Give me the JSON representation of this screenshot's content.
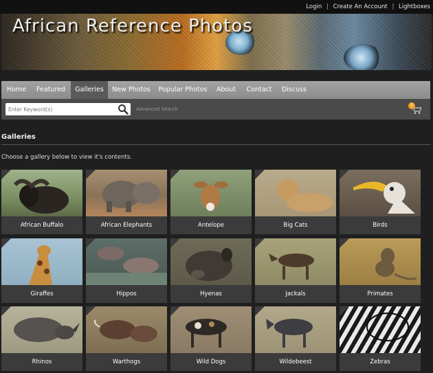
{
  "top_links": [
    "Login",
    "Create An Account",
    "Lightboxes"
  ],
  "site_title": "African Reference Photos",
  "nav": {
    "items": [
      "Home",
      "Featured",
      "Galleries",
      "New Photos",
      "Popular Photos",
      "About",
      "Contact",
      "Discuss"
    ],
    "active": "Galleries"
  },
  "search": {
    "placeholder": "Enter Keyword(s)",
    "advanced_label": "Advanced Search",
    "cart_count": "0"
  },
  "page": {
    "heading": "Galleries",
    "intro": "Choose a gallery below to view it's contents."
  },
  "galleries": [
    {
      "label": "African Buffalo",
      "icon": "buffalo-image"
    },
    {
      "label": "African Elephants",
      "icon": "elephants-image"
    },
    {
      "label": "Antelope",
      "icon": "antelope-image"
    },
    {
      "label": "Big Cats",
      "icon": "big-cats-image"
    },
    {
      "label": "Birds",
      "icon": "birds-image"
    },
    {
      "label": "Giraffes",
      "icon": "giraffes-image"
    },
    {
      "label": "Hippos",
      "icon": "hippos-image"
    },
    {
      "label": "Hyenas",
      "icon": "hyenas-image"
    },
    {
      "label": "Jackals",
      "icon": "jackals-image"
    },
    {
      "label": "Primates",
      "icon": "primates-image"
    },
    {
      "label": "Rhinos",
      "icon": "rhinos-image"
    },
    {
      "label": "Warthogs",
      "icon": "warthogs-image"
    },
    {
      "label": "Wild Dogs",
      "icon": "wild-dogs-image"
    },
    {
      "label": "Wildebeest",
      "icon": "wildebeest-image"
    },
    {
      "label": "Zebras",
      "icon": "zebras-image"
    }
  ],
  "colors": {
    "background": "#1f1f1f",
    "nav_bar": "#9a9a9a",
    "nav_active": "#5a5a5a",
    "search_bar": "#4a4a4a",
    "card": "#3b3b3b",
    "cart_badge": "#f0a020"
  }
}
